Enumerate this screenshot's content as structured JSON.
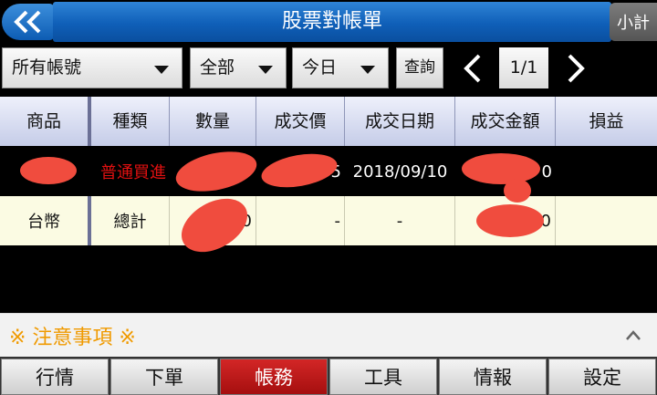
{
  "header": {
    "title": "股票對帳單",
    "subtotal_label": "小計"
  },
  "filters": {
    "account": "所有帳號",
    "type": "全部",
    "period": "今日",
    "query_label": "查詢",
    "page": "1/1"
  },
  "table": {
    "columns": [
      "商品",
      "種類",
      "數量",
      "成交價",
      "成交日期",
      "成交金額",
      "損益"
    ],
    "rows": [
      {
        "product": "",
        "kind": "普通買進",
        "qty": "",
        "price": "5",
        "date": "2018/09/10",
        "amount": "0",
        "pnl": ""
      },
      {
        "product": "台幣",
        "kind": "總計",
        "qty": "0",
        "price": "-",
        "date": "-",
        "amount": "0",
        "pnl": ""
      }
    ]
  },
  "notice": {
    "label": "※ 注意事項 ※"
  },
  "tabs": [
    "行情",
    "下單",
    "帳務",
    "工具",
    "情報",
    "設定"
  ],
  "active_tab": "帳務",
  "colors": {
    "header_blue": "#0f5fb8",
    "active_tab_red": "#c01818",
    "notice_orange": "#f09a00",
    "total_row_bg": "#fbfbe3"
  }
}
